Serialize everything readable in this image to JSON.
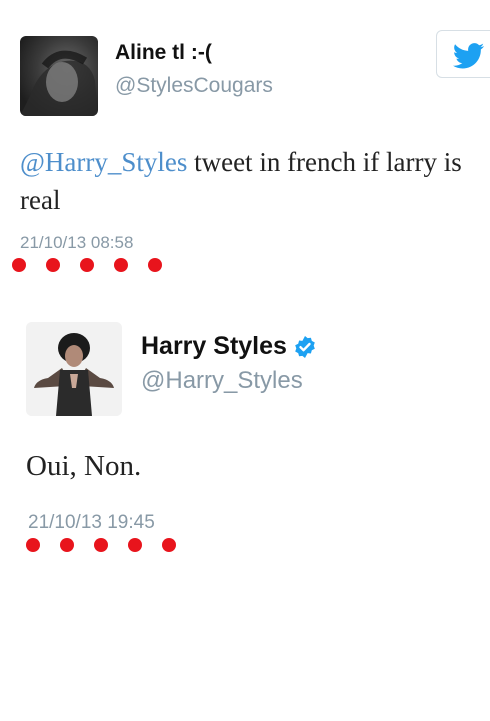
{
  "colors": {
    "mention": "#4d8ecb",
    "handle": "#8899a6",
    "dots": "#e8141c",
    "verified": "#1da1f2",
    "twitter_bird": "#1da1f2"
  },
  "tweet1": {
    "author_name": "Aline tl :-(",
    "author_handle": "@StylesCougars",
    "mention": "@Harry_Styles",
    "text": " tweet in french if larry is real",
    "timestamp": "21/10/13 08:58",
    "icons": {
      "avatar": "avatar",
      "follow": "twitter-bird-icon"
    }
  },
  "tweet2": {
    "author_name": "Harry Styles",
    "author_handle": "@Harry_Styles",
    "verified": true,
    "text": "Oui, Non.",
    "timestamp": "21/10/13 19:45",
    "icons": {
      "avatar": "avatar",
      "verified": "verified-badge-icon"
    }
  }
}
